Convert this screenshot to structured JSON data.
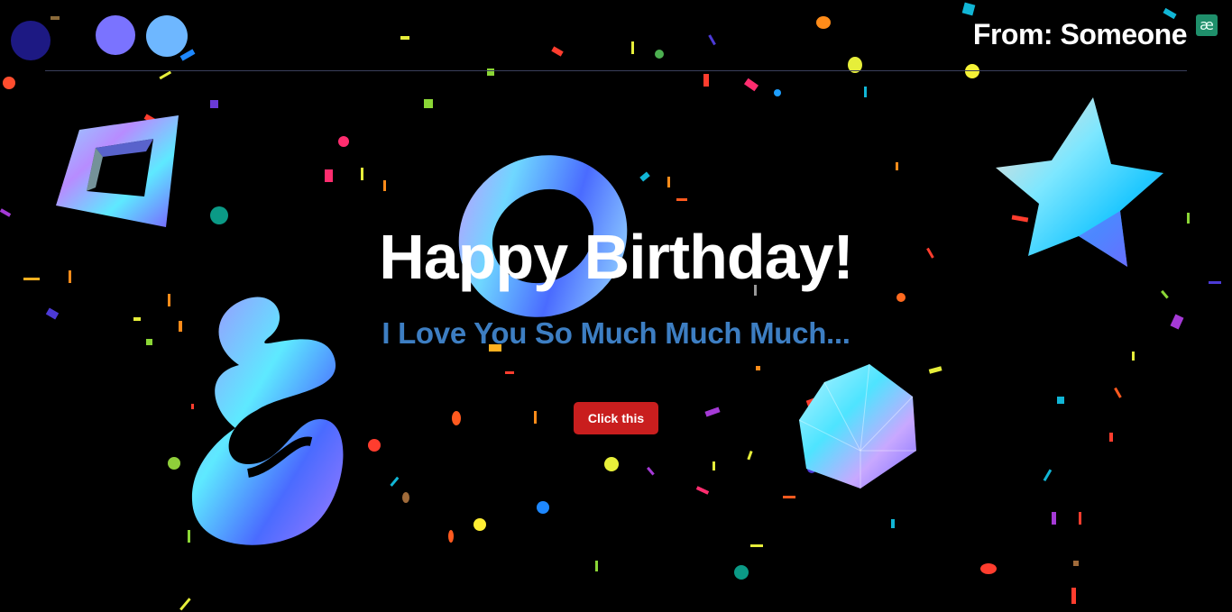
{
  "header": {
    "from_text": "From: Someone",
    "logo_glyph": "æ"
  },
  "hero": {
    "title": "Happy Birthday!",
    "subtitle": "I Love You So Much Much Much...",
    "button_label": "Click this"
  },
  "colors": {
    "background": "#000000",
    "title": "#ffffff",
    "subtitle": "#3d7ec2",
    "button": "#c91e1e",
    "dot_dark": "#1d1983",
    "dot_violet": "#7a73ff",
    "dot_sky": "#6eb7ff"
  },
  "decorations": [
    "holographic-square-frame",
    "holographic-torus",
    "holographic-star",
    "holographic-ribbon",
    "holographic-icosahedron",
    "confetti"
  ]
}
